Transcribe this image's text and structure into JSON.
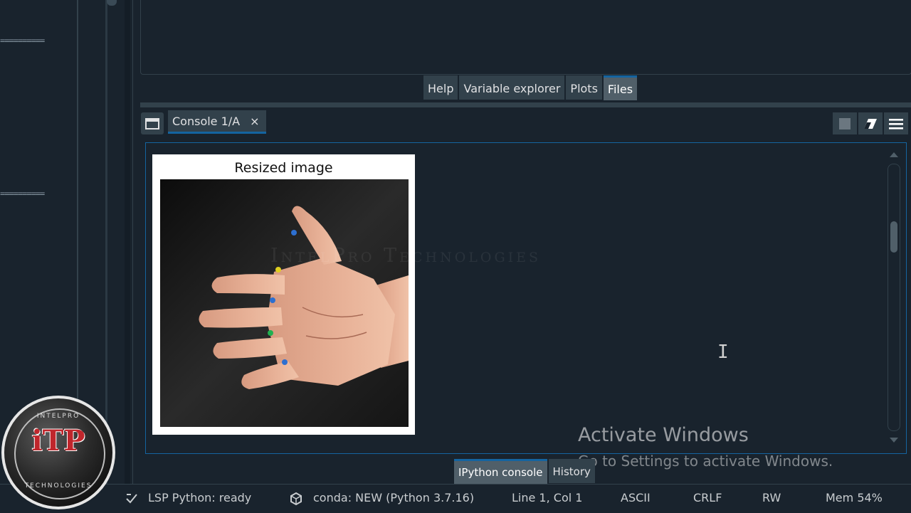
{
  "top_tabs": [
    {
      "label": "Help",
      "active": false
    },
    {
      "label": "Variable explorer",
      "active": false
    },
    {
      "label": "Plots",
      "active": false
    },
    {
      "label": "Files",
      "active": true
    }
  ],
  "console": {
    "tab_label": "Console 1/A",
    "close_glyph": "×"
  },
  "figure": {
    "title": "Resized image"
  },
  "watermark": "IntelPro Technologies",
  "activate": {
    "title": "Activate Windows",
    "subtitle": "Go to Settings to activate Windows."
  },
  "bottom_tabs": [
    {
      "label": "IPython console",
      "active": true
    },
    {
      "label": "History",
      "active": false
    }
  ],
  "status": {
    "lsp": "LSP Python: ready",
    "conda": "conda: NEW (Python 3.7.16)",
    "position": "Line 1, Col 1",
    "encoding": "ASCII",
    "eol": "CRLF",
    "mode": "RW",
    "memory": "Mem 54%"
  },
  "editor_markers": [
    "==========",
    "=========="
  ],
  "logo": {
    "monogram": "iTP",
    "ring_top": "INTELPRO",
    "ring_bottom": "TECHNOLOGIES"
  },
  "colors": {
    "background": "#19232d",
    "panel": "#32414b",
    "accent": "#1464a0",
    "active_tab": "#505f69"
  },
  "icons": [
    "maximize-pane-icon",
    "stop-icon",
    "eraser-icon",
    "menu-icon",
    "lsp-icon",
    "conda-icon",
    "text-cursor-icon"
  ]
}
